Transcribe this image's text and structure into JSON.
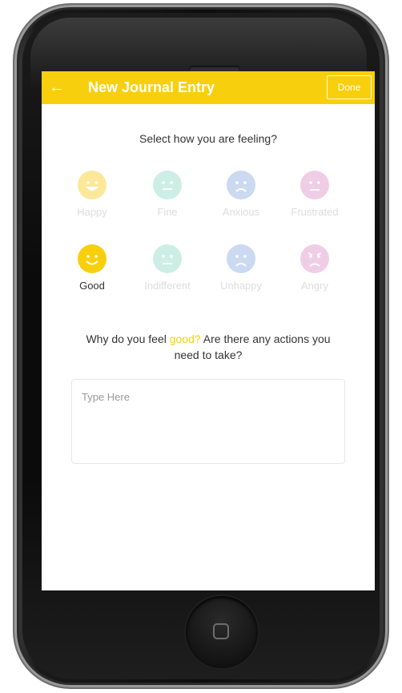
{
  "appbar": {
    "title": "New Journal Entry",
    "back_icon": "arrow-left-icon",
    "done_label": "Done",
    "color": "#f8cf0c"
  },
  "prompt": "Select how you are feeling?",
  "moods": [
    {
      "label": "Happy",
      "color": "#fbe89a",
      "icon": "grin-face-icon",
      "selected": false
    },
    {
      "label": "Fine",
      "color": "#cdeee4",
      "icon": "neutral-face-icon",
      "selected": false
    },
    {
      "label": "Anxious",
      "color": "#cbd9f1",
      "icon": "worried-face-icon",
      "selected": false
    },
    {
      "label": "Frustrated",
      "color": "#f0cde6",
      "icon": "annoyed-face-icon",
      "selected": false
    },
    {
      "label": "Good",
      "color": "#f8cf0c",
      "icon": "smile-face-icon",
      "selected": true
    },
    {
      "label": "Indifferent",
      "color": "#cdeee4",
      "icon": "flat-face-icon",
      "selected": false
    },
    {
      "label": "Unhappy",
      "color": "#cbd9f1",
      "icon": "sad-face-icon",
      "selected": false
    },
    {
      "label": "Angry",
      "color": "#f0cde6",
      "icon": "angry-face-icon",
      "selected": false
    }
  ],
  "question": {
    "before": "Why do you feel ",
    "highlight": "good?",
    "after": " Are there any actions you need to take?"
  },
  "entry": {
    "placeholder": "Type Here",
    "value": ""
  }
}
